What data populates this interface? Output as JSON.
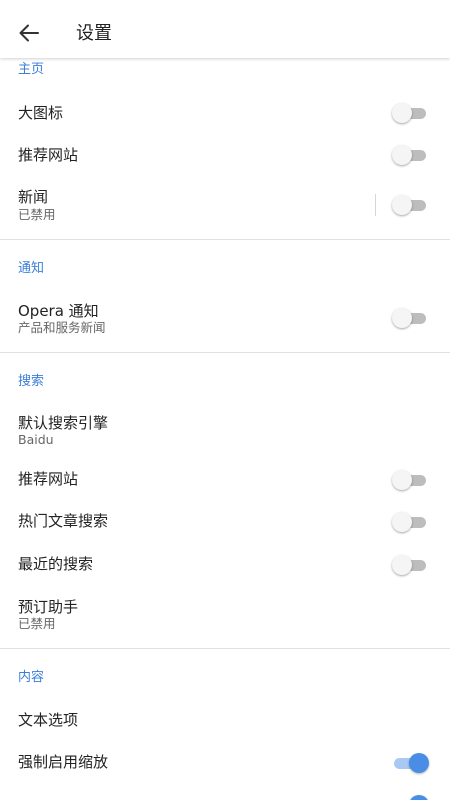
{
  "header": {
    "title": "设置"
  },
  "sections": {
    "home": {
      "title": "主页",
      "large_icons": {
        "label": "大图标",
        "enabled": false
      },
      "recommended_sites": {
        "label": "推荐网站",
        "enabled": false
      },
      "news": {
        "label": "新闻",
        "subtitle": "已禁用",
        "enabled": false
      }
    },
    "notifications": {
      "title": "通知",
      "opera_notifications": {
        "label": "Opera 通知",
        "subtitle": "产品和服务新闻",
        "enabled": false
      }
    },
    "search": {
      "title": "搜索",
      "default_engine": {
        "label": "默认搜索引擎",
        "subtitle": "Baidu"
      },
      "recommended_sites": {
        "label": "推荐网站",
        "enabled": false
      },
      "trending_articles": {
        "label": "热门文章搜索",
        "enabled": false
      },
      "recent_searches": {
        "label": "最近的搜索",
        "enabled": false
      },
      "booking_assistant": {
        "label": "预订助手",
        "subtitle": "已禁用"
      }
    },
    "content": {
      "title": "内容",
      "text_options": {
        "label": "文本选项"
      },
      "force_zoom": {
        "label": "强制启用缩放",
        "enabled": true
      }
    }
  },
  "colors": {
    "accent": "#4a8de6",
    "section_header": "#3b7fd9",
    "toggle_off_track": "#bdbdbd",
    "toggle_off_knob": "#f5f5f5",
    "divider": "#e0e0e0"
  },
  "icons": {
    "back": "arrow-left-icon"
  }
}
